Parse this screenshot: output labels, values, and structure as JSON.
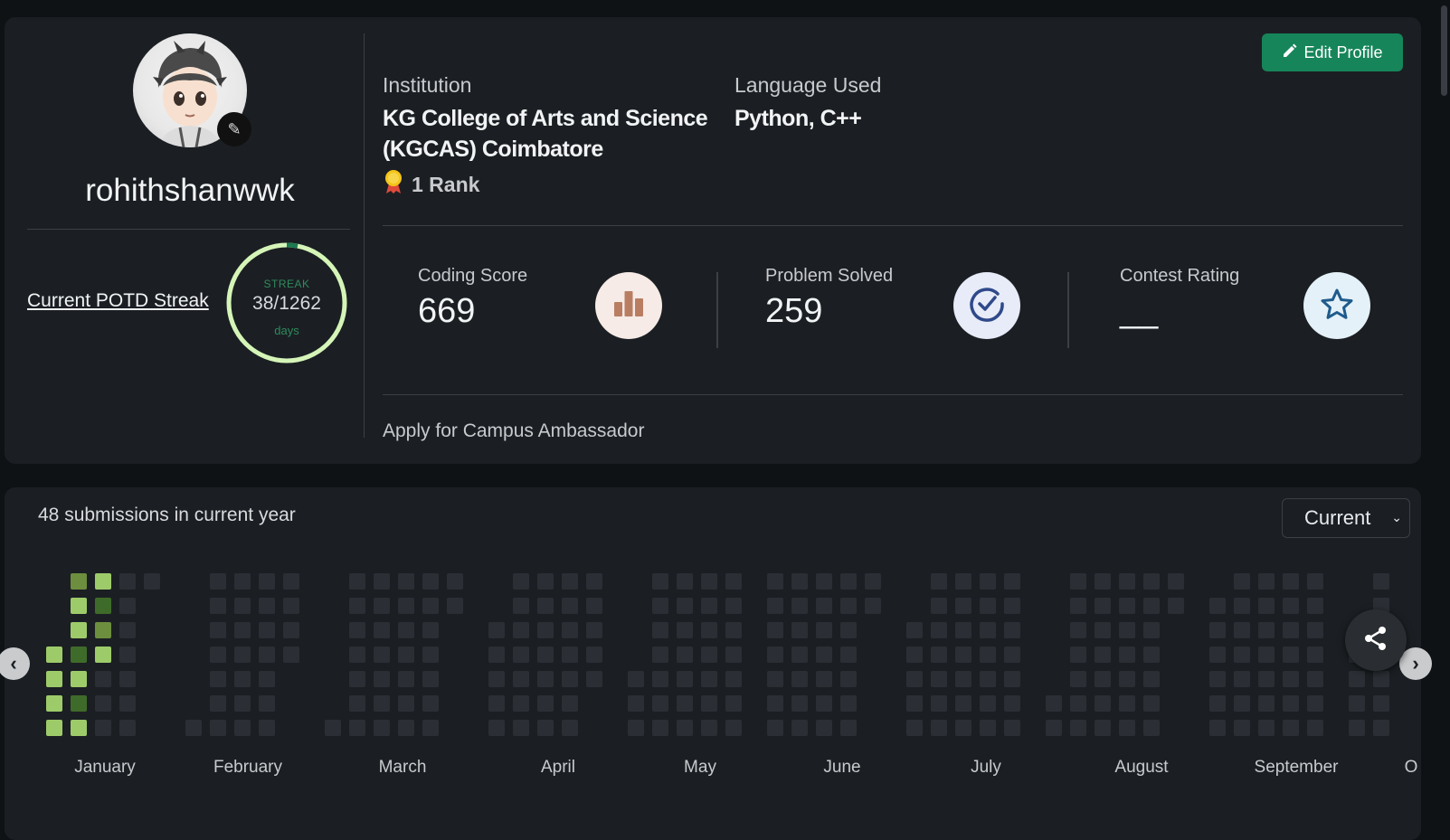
{
  "profile": {
    "username": "rohithshanwwk",
    "streak": {
      "link_label": "Current POTD Streak",
      "label": "STREAK",
      "value": "38/1262",
      "unit": "days",
      "progress": 0.03
    },
    "edit_button_label": "Edit Profile",
    "institution_label": "Institution",
    "institution_value_line1": "KG College of Arts and Science",
    "institution_value_line2": "(KGCAS) Coimbatore",
    "rank_text": "1 Rank",
    "language_label": "Language Used",
    "language_value": "Python, C++",
    "stats": [
      {
        "label": "Coding Score",
        "value": "669",
        "icon": "bar-chart-icon",
        "icon_bg": "#f6ebe6",
        "icon_color": "#b97e62"
      },
      {
        "label": "Problem Solved",
        "value": "259",
        "icon": "check-circle-icon",
        "icon_bg": "#e8ecf8",
        "icon_color": "#2f4a8a"
      },
      {
        "label": "Contest Rating",
        "value": "__",
        "icon": "star-icon",
        "icon_bg": "#e4f1f8",
        "icon_color": "#1f5b8c"
      }
    ],
    "ambassador_link": "Apply for Campus Ambassador"
  },
  "heatmap": {
    "title": "48 submissions in current year",
    "year_select_value": "Current",
    "months": [
      "January",
      "February",
      "March",
      "April",
      "May",
      "June",
      "July",
      "August",
      "September",
      "O"
    ]
  },
  "colors": {
    "accent": "#16855a",
    "streak_ring": "#d5f5b8",
    "streak_progress": "#1e7a52",
    "cell_empty": "#2b2f35",
    "cell_light": "#9ecb6a",
    "cell_mid": "#6d8e3e",
    "cell_dark": "#3f6b2a"
  }
}
